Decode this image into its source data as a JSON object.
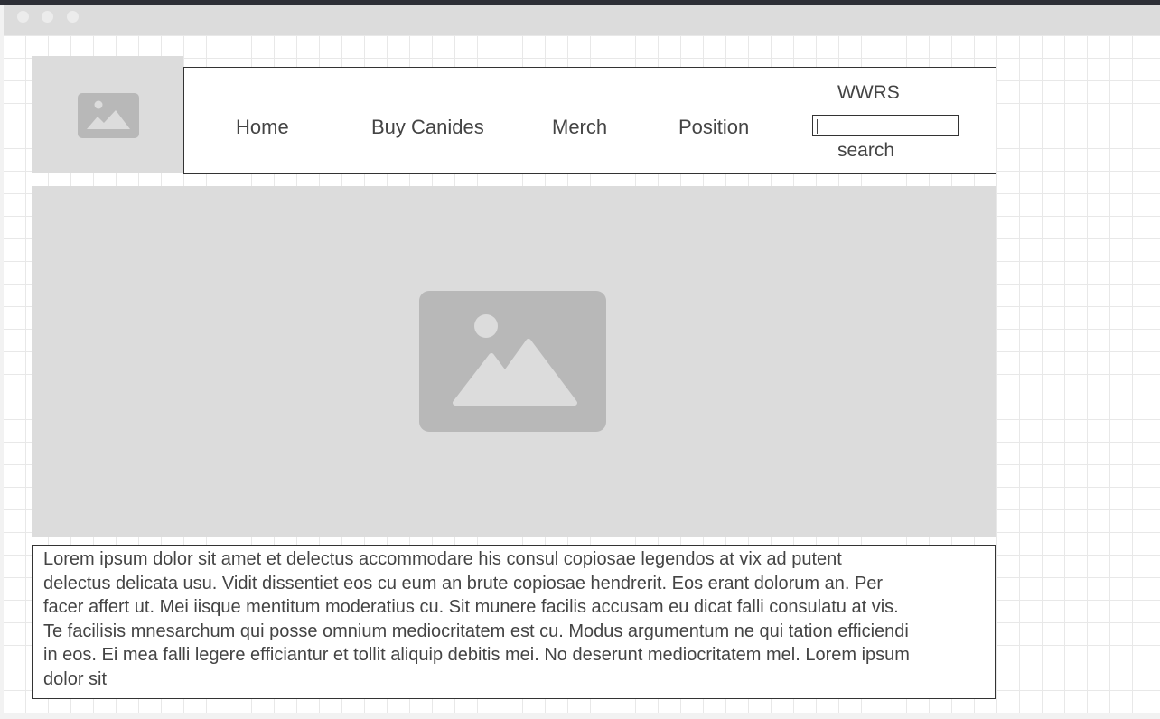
{
  "nav": {
    "items": [
      "Home",
      "Buy Canides",
      "Merch",
      "Position"
    ],
    "site_title": "WWRS",
    "search_label": "search"
  },
  "search": {
    "value": ""
  },
  "body_text": "Lorem ipsum dolor sit amet et delectus accommodare his consul copiosae legendos at vix ad putent delectus delicata usu. Vidit dissentiet eos cu eum an brute copiosae hendrerit. Eos erant dolorum an. Per facer affert ut. Mei iisque mentitum moderatius cu. Sit munere facilis accusam eu dicat falli consulatu at vis. Te facilisis mnesarchum qui posse omnium mediocritatem est cu. Modus argumentum ne qui tation efficiendi in eos. Ei mea falli legere efficiantur et tollit aliquip debitis mei. No deserunt mediocritatem mel. Lorem ipsum dolor sit",
  "colors": {
    "placeholder_bg": "#dcdcdc",
    "placeholder_icon": "#b8b8b8",
    "text": "#444444",
    "border": "#333333"
  },
  "icons": {
    "logo": "image-placeholder-icon",
    "hero": "image-placeholder-icon"
  }
}
